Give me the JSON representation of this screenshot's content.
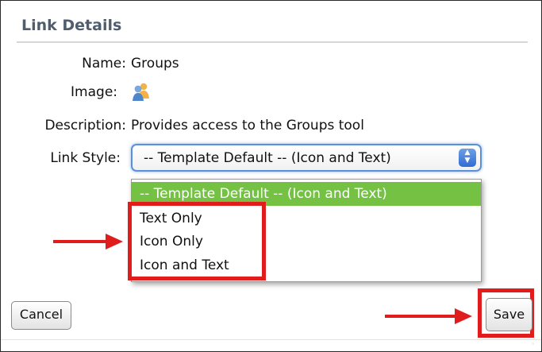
{
  "panel": {
    "title": "Link Details"
  },
  "fields": {
    "name_label": "Name:",
    "name_value": "Groups",
    "image_label": "Image:",
    "image_icon": "groups-icon",
    "description_label": "Description:",
    "description_value": "Provides access to the Groups tool",
    "link_style_label": "Link Style:"
  },
  "link_style_select": {
    "selected": "-- Template Default -- (Icon and Text)",
    "options": [
      "-- Template Default -- (Icon and Text)",
      "Text Only",
      "Icon Only",
      "Icon and Text"
    ]
  },
  "buttons": {
    "cancel_label": "Cancel",
    "save_label": "Save"
  },
  "colors": {
    "highlight": "#e11c1c",
    "selected_option": "#74c144",
    "title": "#4f5d6e",
    "select_focus": "#5b8fd8"
  }
}
